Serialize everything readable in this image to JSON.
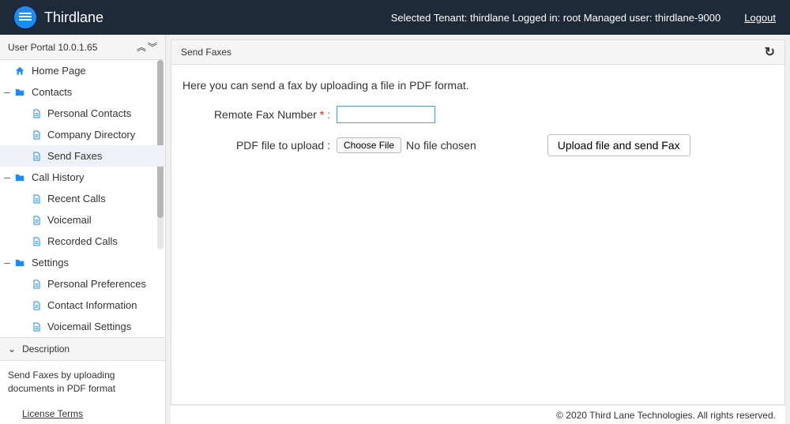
{
  "topbar": {
    "brand": "Thirdlane",
    "info": "Selected Tenant: thirdlane  Logged in: root  Managed user: thirdlane-9000",
    "logout": "Logout"
  },
  "sidebar": {
    "title": "User Portal 10.0.1.65",
    "items": [
      {
        "label": "Home Page",
        "icon": "home",
        "level": 0,
        "toggle": ""
      },
      {
        "label": "Contacts",
        "icon": "folder",
        "level": 0,
        "toggle": "–"
      },
      {
        "label": "Personal Contacts",
        "icon": "file",
        "level": 1
      },
      {
        "label": "Company Directory",
        "icon": "file",
        "level": 1
      },
      {
        "label": "Send Faxes",
        "icon": "file",
        "level": 1,
        "selected": true
      },
      {
        "label": "Call History",
        "icon": "folder",
        "level": 0,
        "toggle": "–"
      },
      {
        "label": "Recent Calls",
        "icon": "file",
        "level": 1
      },
      {
        "label": "Voicemail",
        "icon": "file",
        "level": 1
      },
      {
        "label": "Recorded Calls",
        "icon": "file",
        "level": 1
      },
      {
        "label": "Settings",
        "icon": "folder",
        "level": 0,
        "toggle": "–"
      },
      {
        "label": "Personal Preferences",
        "icon": "file",
        "level": 1
      },
      {
        "label": "Contact Information",
        "icon": "file",
        "level": 1
      },
      {
        "label": "Voicemail Settings",
        "icon": "file",
        "level": 1
      }
    ],
    "description_header": "Description",
    "description_body": "Send Faxes by uploading documents in PDF format",
    "license": "License Terms"
  },
  "content": {
    "title": "Send Faxes",
    "intro": "Here you can send a fax by uploading a file in PDF format.",
    "remote_label": "Remote Fax Number",
    "remote_required": " * :",
    "pdf_label": "PDF file to upload :",
    "choose_file": "Choose File",
    "no_file": "No file chosen",
    "upload_btn": "Upload file and send Fax"
  },
  "footer": {
    "copyright": "© 2020 Third Lane Technologies. All rights reserved."
  }
}
